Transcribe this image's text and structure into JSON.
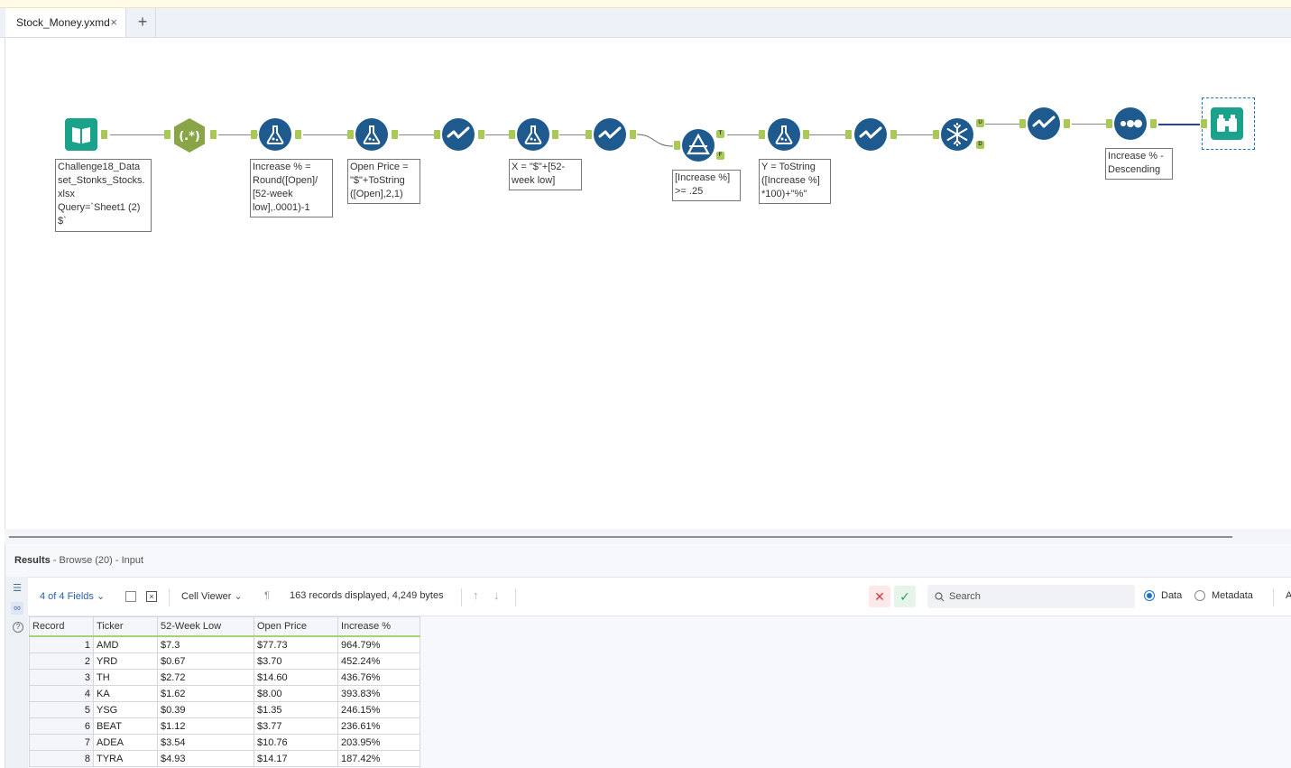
{
  "tabs": [
    {
      "label": "Stock_Money.yxmd"
    }
  ],
  "annotations": {
    "input": "Challenge18_Data\nset_Stonks_Stocks.\nxlsx\nQuery=`Sheet1 (2)\n$`",
    "formula1": "Increase % =\nRound([Open]/\n[52-week\nlow],.0001)-1",
    "formula2": "Open Price =\n\"$\"+ToString\n([Open],2,1)",
    "formula3": "X = \"$\"+[52-\nweek low]",
    "filter": "[Increase %]\n>= .25",
    "formula4": "Y = ToString\n([Increase %]\n*100)+\"%\"",
    "sort": "Increase % -\nDescending"
  },
  "anchors": {
    "true": "T",
    "false": "F",
    "unique": "U",
    "duplicate": "D"
  },
  "results": {
    "title": "Results",
    "subtitle": " - Browse (20) - Input",
    "fields_label": "4 of 4 Fields",
    "viewer_label": "Cell Viewer",
    "records_text": "163 records displayed, 4,249 bytes",
    "search_placeholder": "Search",
    "data_label": "Data",
    "metadata_label": "Metadata",
    "extra_label": "A"
  },
  "table": {
    "columns": [
      "Record",
      "Ticker",
      "52-Week Low",
      "Open Price",
      "Increase %"
    ],
    "rows": [
      [
        "1",
        "AMD",
        "$7.3",
        "$77.73",
        "964.79%"
      ],
      [
        "2",
        "YRD",
        "$0.67",
        "$3.70",
        "452.24%"
      ],
      [
        "3",
        "TH",
        "$2.72",
        "$14.60",
        "436.76%"
      ],
      [
        "4",
        "KA",
        "$1.62",
        "$8.00",
        "393.83%"
      ],
      [
        "5",
        "YSG",
        "$0.39",
        "$1.35",
        "246.15%"
      ],
      [
        "6",
        "BEAT",
        "$1.12",
        "$3.77",
        "236.61%"
      ],
      [
        "7",
        "ADEA",
        "$3.54",
        "$10.76",
        "203.95%"
      ],
      [
        "8",
        "TYRA",
        "$4.93",
        "$14.17",
        "187.42%"
      ]
    ]
  },
  "colors": {
    "tool_blue": "#1f5a8f",
    "anchor_green": "#a8c956",
    "input_teal": "#1aa38a",
    "regex_green": "#8aa548"
  }
}
